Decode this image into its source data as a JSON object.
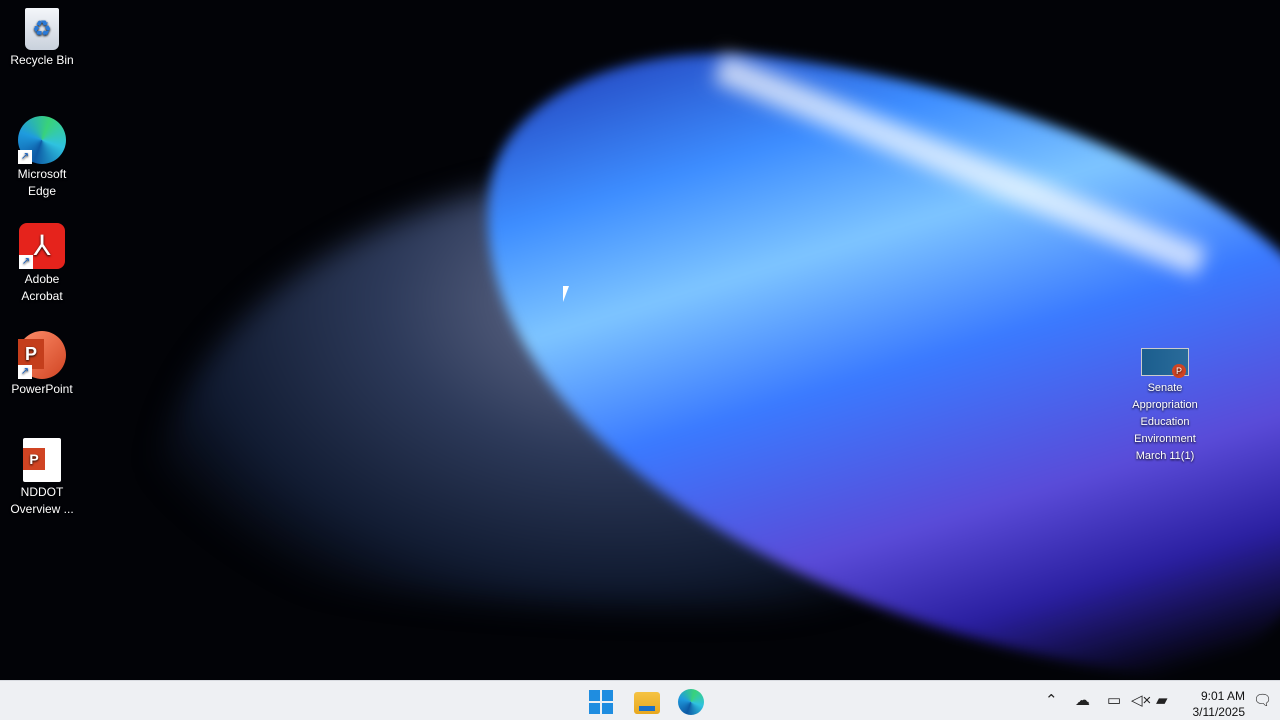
{
  "desktop": {
    "icons": [
      {
        "label": "Recycle Bin",
        "icon": "recycle-bin-icon"
      },
      {
        "label": "Microsoft Edge",
        "icon": "edge-icon"
      },
      {
        "label": "Adobe Acrobat",
        "icon": "acrobat-icon"
      },
      {
        "label": "PowerPoint",
        "icon": "powerpoint-icon"
      },
      {
        "label": "NDDOT Overview ...",
        "icon": "pptx-file-icon"
      }
    ],
    "right_icon": {
      "label": "Senate Appropriation Education Environment March 11(1)",
      "icon": "pptx-thumbnail-icon"
    }
  },
  "taskbar": {
    "apps": [
      "start-icon",
      "file-explorer-icon",
      "edge-icon"
    ],
    "tray": [
      "chevron-up-icon",
      "onedrive-offline-icon",
      "network-icon",
      "volume-muted-icon",
      "battery-icon"
    ],
    "time": "9:01 AM",
    "date": "3/11/2025"
  }
}
